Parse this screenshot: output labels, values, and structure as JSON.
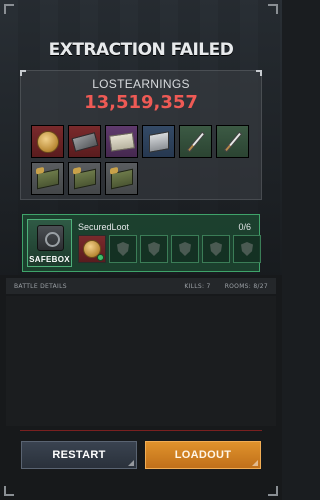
{
  "header": {
    "title": "EXTRACTION FAILED"
  },
  "lost": {
    "label": "LOSTEARNINGS",
    "value": "13,519,357"
  },
  "lost_items": [
    {
      "name": "gold-coin",
      "rarity": "red"
    },
    {
      "name": "ssd-drive",
      "rarity": "red"
    },
    {
      "name": "cash-bundle",
      "rarity": "purple"
    },
    {
      "name": "toolbox",
      "rarity": "blue"
    },
    {
      "name": "pencil",
      "rarity": "green"
    },
    {
      "name": "pencil",
      "rarity": "green"
    },
    {
      "name": "ammo-box",
      "rarity": "gray"
    },
    {
      "name": "ammo-box",
      "rarity": "gray"
    },
    {
      "name": "ammo-box",
      "rarity": "gray"
    }
  ],
  "safebox": {
    "label": "SAFEBOX",
    "secured_label": "SecuredLoot",
    "secured_count": "0/6"
  },
  "battle": {
    "label": "BATTLE DETAILS",
    "kills": "KILLS: 7",
    "rooms": "ROOMS: 8/27"
  },
  "buttons": {
    "restart": "RESTART",
    "loadout": "LOADOUT"
  },
  "colors": {
    "lost_value": "#ee5a55",
    "safebox_green": "#3fa36a",
    "loadout_orange": "#e0922c",
    "restart_slate": "#3a4350"
  }
}
